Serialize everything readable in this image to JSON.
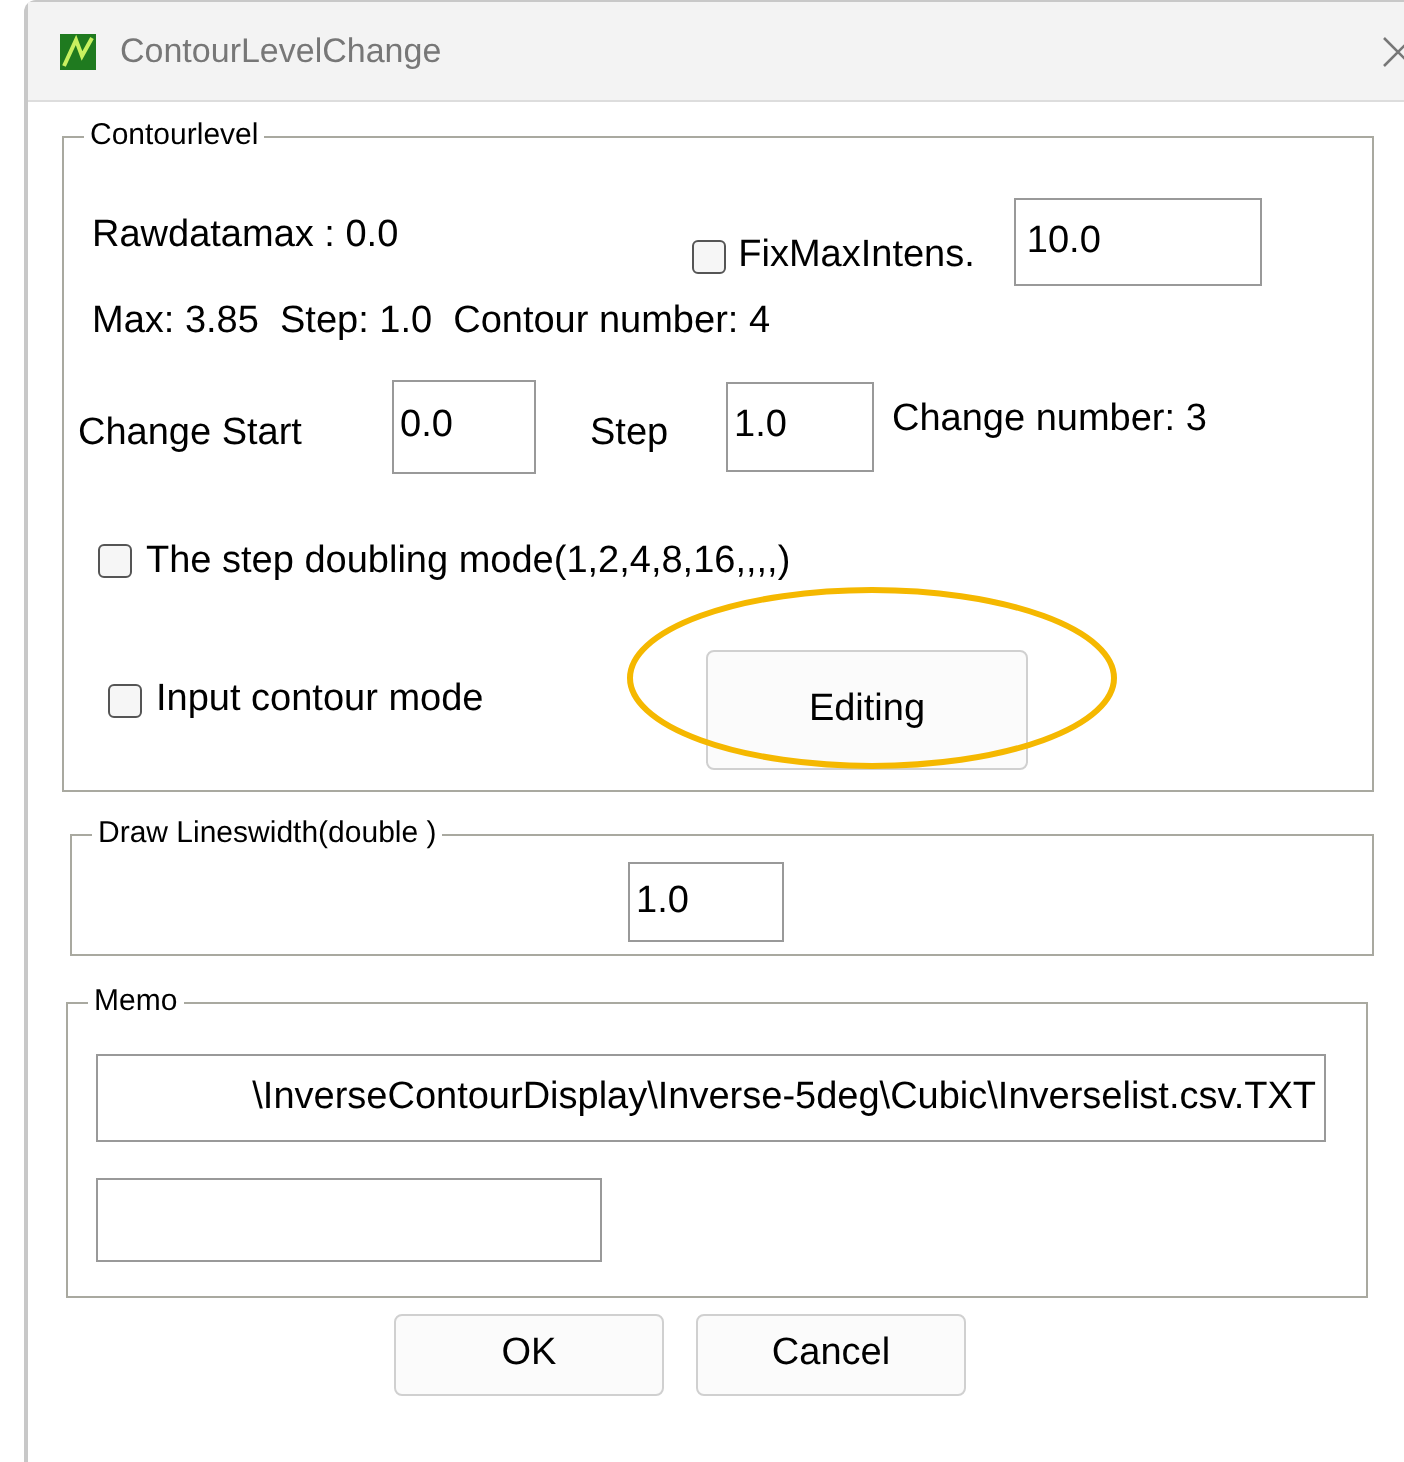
{
  "window": {
    "title": "ContourLevelChange"
  },
  "contour_level": {
    "legend": "Contourlevel",
    "rawdatamax": "Rawdatamax : 0.0",
    "fix_max": {
      "label": "FixMaxIntens.",
      "checked": false,
      "value": "10.0"
    },
    "summary": "Max: 3.85  Step: 1.0  Contour number: 4",
    "change_start": {
      "label": "Change Start",
      "value": "0.0"
    },
    "step": {
      "label": "Step",
      "value": "1.0"
    },
    "change_number": "Change number: 3",
    "doubling": {
      "label": "The step doubling mode(1,2,4,8,16,,,,)",
      "checked": false
    },
    "input_mode": {
      "label": "Input contour mode",
      "checked": false
    },
    "editing_button": {
      "label": "Editing",
      "highlighted": true
    }
  },
  "linewidth": {
    "legend": "Draw Lineswidth(double )",
    "value": "1.0"
  },
  "memo": {
    "legend": "Memo",
    "path": "\\InverseContourDisplay\\Inverse-5deg\\Cubic\\Inverselist.csv.TXT"
  },
  "buttons": [
    "OK",
    "Cancel"
  ]
}
